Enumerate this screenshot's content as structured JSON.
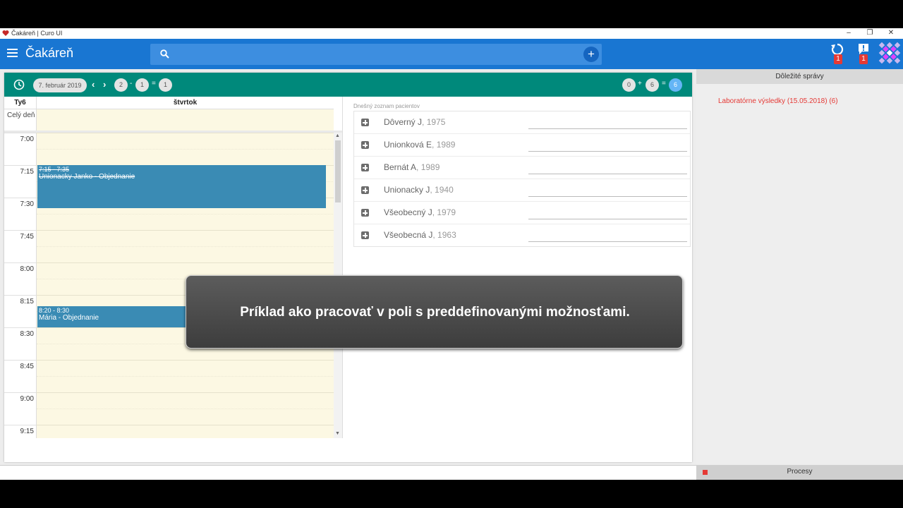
{
  "window": {
    "title": "Čakáreň | Curo UI"
  },
  "header": {
    "title": "Čakáreň",
    "search_placeholder": "",
    "sync_badge": "1",
    "alerts_badge": "1"
  },
  "toolbar": {
    "date": "7. február 2019",
    "counts_left": [
      "2",
      "1",
      "1"
    ],
    "ops_left": [
      "-",
      "="
    ],
    "counts_right": [
      "0",
      "6",
      "6"
    ],
    "ops_right": [
      "+",
      "="
    ]
  },
  "calendar": {
    "week_label": "Ty6",
    "day_label": "štvrtok",
    "all_day_label": "Celý deň",
    "times": [
      "7:00",
      "7:15",
      "7:30",
      "7:45",
      "8:00",
      "8:15",
      "8:30",
      "8:45",
      "9:00",
      "9:15"
    ],
    "events": [
      {
        "time": "7:15 - 7:35",
        "title": "Unionacky Janko - Objednanie",
        "struck": true
      },
      {
        "time": "8:20 - 8:30",
        "title": "Mária - Objednanie",
        "struck": false
      }
    ]
  },
  "patients": {
    "label": "Dnešný zoznam pacientov",
    "items": [
      {
        "name": "Dôverný J",
        "year": ", 1975"
      },
      {
        "name": "Unionková E",
        "year": ", 1989"
      },
      {
        "name": "Bernát A",
        "year": ", 1989"
      },
      {
        "name": "Unionacky J",
        "year": ", 1940"
      },
      {
        "name": "Všeobecný J",
        "year": ", 1979"
      },
      {
        "name": "Všeobecná J",
        "year": ", 1963"
      }
    ]
  },
  "right_panel": {
    "title": "Dôležité správy",
    "message": "Laboratórne výsledky (15.05.2018) (6)"
  },
  "bottom": {
    "processes_label": "Procesy"
  },
  "caption": {
    "text": "Príklad ako pracovať v poli s preddefinovanými možnosťami."
  },
  "colors": {
    "header": "#1976d2",
    "toolbar": "#00897b",
    "event": "#3a8bb4",
    "alert": "#e53935",
    "slot": "#fcf8e3"
  }
}
